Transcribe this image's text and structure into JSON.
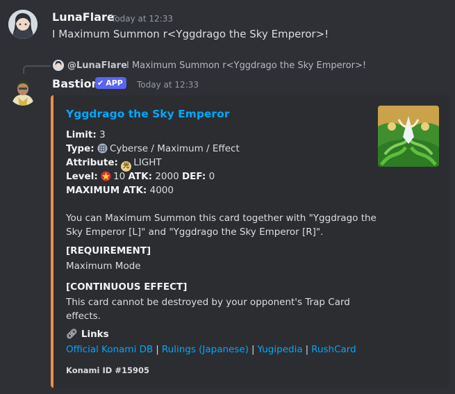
{
  "message1": {
    "author": "LunaFlare",
    "timestamp": "Today at 12:33",
    "content": "I Maximum Summon r<Yggdrago the Sky Emperor>!"
  },
  "message2": {
    "reply": {
      "mention": "@LunaFlare",
      "text": "I Maximum Summon r<Yggdrago the Sky Emperor>!"
    },
    "author": "Bastion",
    "app_badge": "APP",
    "timestamp": "Today at 12:33",
    "embed": {
      "accent_color": "#f38b4a",
      "title": "Yggdrago the Sky Emperor",
      "limit_label": "Limit",
      "limit_value": "3",
      "type_label": "Type",
      "type_value": "Cyberse / Maximum / Effect",
      "attribute_label": "Attribute",
      "attribute_icon_glyph": "光",
      "attribute_value": "LIGHT",
      "level_label": "Level",
      "level_value": "10",
      "atk_label": "ATK",
      "atk_value": "2000",
      "def_label": "DEF",
      "def_value": "0",
      "max_atk_label": "MAXIMUM ATK",
      "max_atk_value": "4000",
      "description_lines": [
        "You can Maximum Summon this card together with \"Yggdrago the",
        "Sky Emperor [L]\" and \"Yggdrago the Sky Emperor [R]\"."
      ],
      "requirement_header": "[REQUIREMENT]",
      "requirement_text": "Maximum Mode",
      "effect_header": "[CONTINUOUS EFFECT]",
      "effect_lines": [
        "This card cannot be destroyed by your opponent's Trap Card",
        "effects."
      ],
      "links_header": "Links",
      "links": [
        "Official Konami DB",
        "Rulings (Japanese)",
        "Yugipedia",
        "RushCard"
      ],
      "footer": "Konami ID #15905"
    }
  },
  "colors": {
    "link": "#00a8fc",
    "app_badge": "#5865f2",
    "accent": "#f38b4a"
  },
  "icons": {
    "type_icon": "cyberse-type-icon",
    "attribute_icon": "light-attribute-icon",
    "level_icon": "level-star-icon",
    "links_icon": "link-icon"
  }
}
